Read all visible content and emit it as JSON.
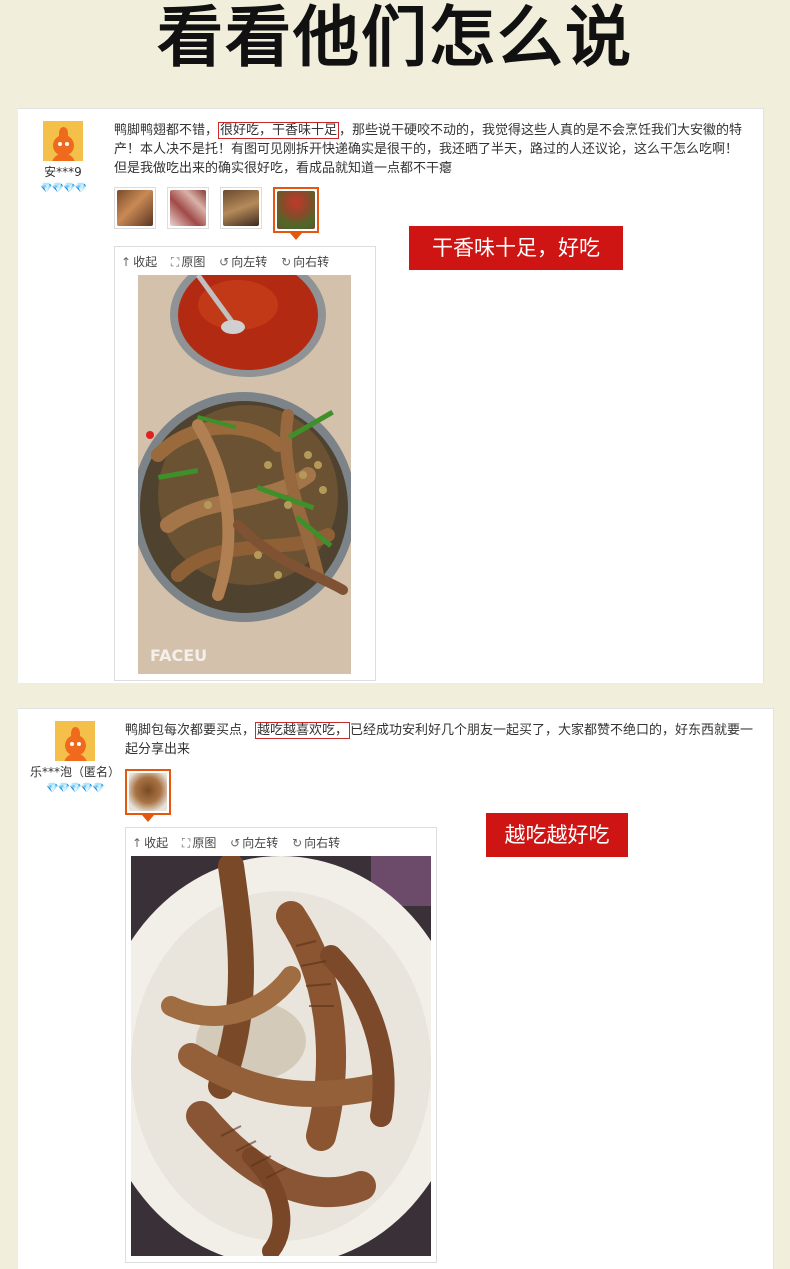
{
  "title": "看看他们怎么说",
  "reviews": [
    {
      "nickname": "安***9",
      "hearts": "💎💎💎💎",
      "text_before": "鸭脚鸭翅都不错，",
      "text_highlight": "很好吃，干香味十足",
      "text_after": "，那些说干硬咬不动的，我觉得这些人真的是不会烹饪我们大安徽的特产！本人决不是托！有图可见刚拆开快递确实是很干的，我还晒了半天，路过的人还议论，这么干怎么吃啊！但是我做吃出来的确实很好吃，看成品就知道一点都不干瘪",
      "tag": "干香味十足，好吃"
    },
    {
      "nickname": "乐***泡（匿名）",
      "hearts": "💎💎💎💎💎",
      "text_before": "鸭脚包每次都要买点，",
      "text_highlight": "越吃越喜欢吃，",
      "text_after": "已经成功安利好几个朋友一起买了，大家都赞不绝口的，好东西就要一起分享出来",
      "tag": "越吃越好吃"
    }
  ],
  "toolbar": {
    "collapse": "收起",
    "original": "原图",
    "rotate_left": "向左转",
    "rotate_right": "向右转",
    "collapse_icon": "arrow-up-icon",
    "original_icon": "expand-icon",
    "rotate_left_icon": "rotate-left-icon",
    "rotate_right_icon": "rotate-right-icon"
  },
  "photo_watermark": "FACEU",
  "colors": {
    "background": "#f1eedc",
    "tag_bg": "#cf1414",
    "highlight_border": "#c62a2a",
    "active_thumb": "#e4570d",
    "avatar_bg": "#f5c04a",
    "avatar_fg": "#ef6a1d"
  }
}
